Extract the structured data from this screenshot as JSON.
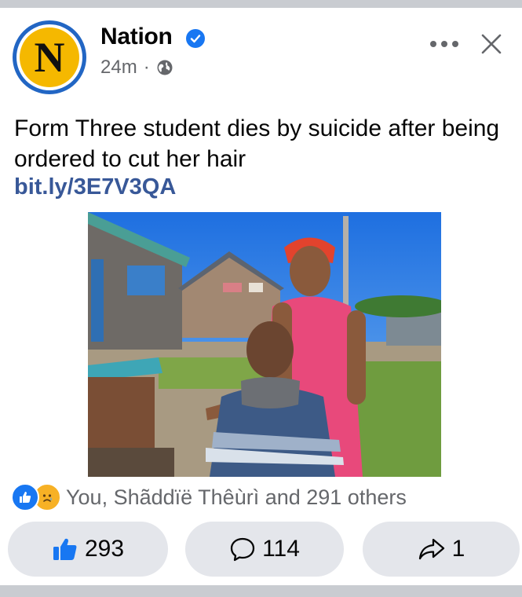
{
  "post": {
    "page_name": "Nation",
    "avatar_letter": "N",
    "time": "24m",
    "separator": "·",
    "caption": "Form Three student dies by suicide after being ordered to cut her hair",
    "link": "bit.ly/3E7V3QA",
    "image_icon": "news-photo"
  },
  "reactions": {
    "icons": [
      "like-icon",
      "sad-icon"
    ],
    "summary": "You, Shãddïë Thêùrì and 291 others"
  },
  "actions": {
    "like_count": "293",
    "comment_count": "114",
    "share_count": "1"
  },
  "colors": {
    "accent": "#1877f2",
    "link": "#385898",
    "muted": "#65676b",
    "button_bg": "#e4e6eb",
    "brand_yellow": "#f5b800"
  }
}
